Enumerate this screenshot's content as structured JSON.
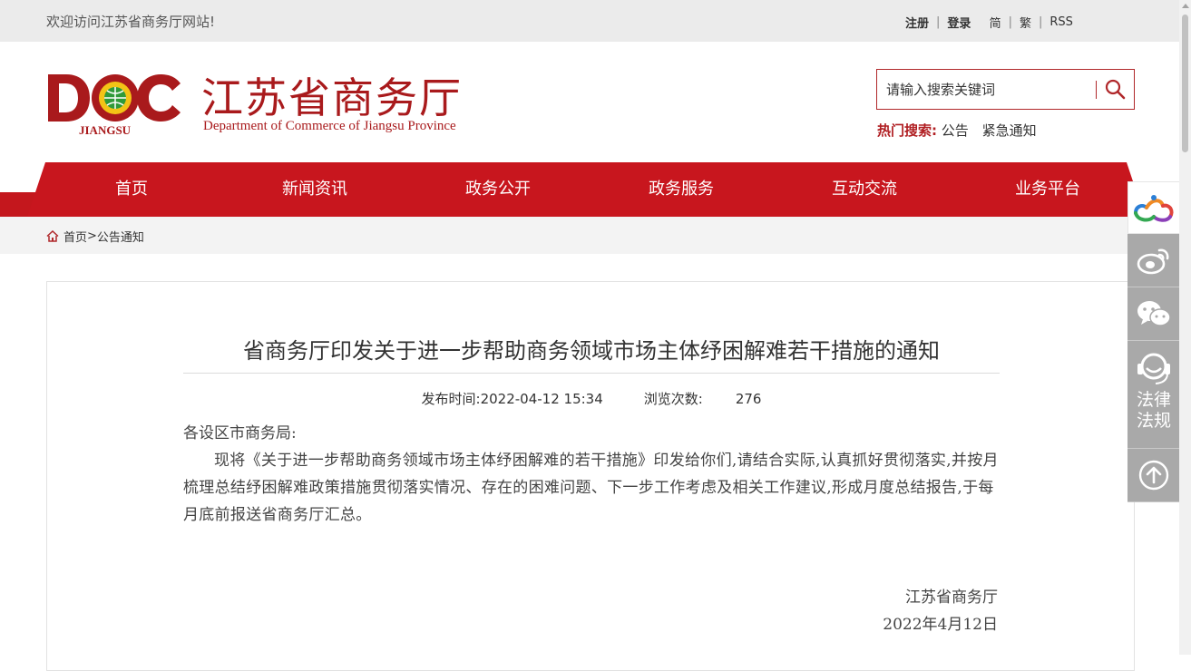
{
  "topbar": {
    "welcome": "欢迎访问江苏省商务厅网站!",
    "links": {
      "register": "注册",
      "login": "登录",
      "simplified": "简",
      "traditional": "繁",
      "rss": "RSS"
    }
  },
  "header": {
    "logo_text": "DOC",
    "logo_sub": "JIANGSU",
    "site_name": "江苏省商务厅",
    "site_name_en": "Department of Commerce of Jiangsu Province"
  },
  "search": {
    "placeholder": "请输入搜索关键词",
    "hot_label": "热门搜索:",
    "hot_keywords": [
      "公告",
      "紧急通知"
    ]
  },
  "nav": {
    "items": [
      "首页",
      "新闻资讯",
      "政务公开",
      "政务服务",
      "互动交流",
      "业务平台"
    ]
  },
  "breadcrumb": {
    "home": "首页",
    "sep": ">",
    "current": "公告通知"
  },
  "article": {
    "title": "省商务厅印发关于进一步帮助商务领域市场主体纾困解难若干措施的通知",
    "publish_label": "发布时间:",
    "publish_time": "2022-04-12 15:34",
    "views_label": "浏览次数:",
    "views": "276",
    "salutation": "各设区市商务局:",
    "paragraph": "现将《关于进一步帮助商务领域市场主体纾困解难的若干措施》印发给你们,请结合实际,认真抓好贯彻落实,并按月梳理总结纾困解难政策措施贯彻落实情况、存在的困难问题、下一步工作考虑及相关工作建议,形成月度总结报告,于每月底前报送省商务厅汇总。",
    "signer": "江苏省商务厅",
    "date": "2022年4月12日"
  },
  "float_bar": {
    "legal_label_1": "法律",
    "legal_label_2": "法规"
  },
  "colors": {
    "brand_red": "#c8161e",
    "logo_red": "#a91a1c",
    "float_gray": "#a9a9a9"
  }
}
